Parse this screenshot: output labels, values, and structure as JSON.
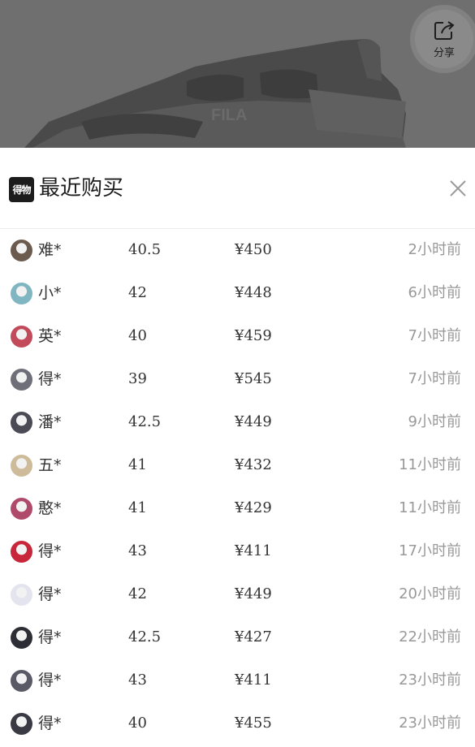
{
  "hero": {
    "share_label": "分享"
  },
  "sheet": {
    "brand_text": "得物",
    "title": "最近购买"
  },
  "purchases": [
    {
      "name": "难*",
      "size": "40.5",
      "price": "¥450",
      "time": "2小时前",
      "avatar_color": "#6b5a4e"
    },
    {
      "name": "小*",
      "size": "42",
      "price": "¥448",
      "time": "6小时前",
      "avatar_color": "#7fb6c2"
    },
    {
      "name": "英*",
      "size": "40",
      "price": "¥459",
      "time": "7小时前",
      "avatar_color": "#c24a5a"
    },
    {
      "name": "得*",
      "size": "39",
      "price": "¥545",
      "time": "7小时前",
      "avatar_color": "#6f6f7a"
    },
    {
      "name": "潘*",
      "size": "42.5",
      "price": "¥449",
      "time": "9小时前",
      "avatar_color": "#4b4b55"
    },
    {
      "name": "五*",
      "size": "41",
      "price": "¥432",
      "time": "11小时前",
      "avatar_color": "#cdbb9a"
    },
    {
      "name": "憨*",
      "size": "41",
      "price": "¥429",
      "time": "11小时前",
      "avatar_color": "#b04a6a"
    },
    {
      "name": "得*",
      "size": "43",
      "price": "¥411",
      "time": "17小时前",
      "avatar_color": "#c8263a"
    },
    {
      "name": "得*",
      "size": "42",
      "price": "¥449",
      "time": "20小时前",
      "avatar_color": "#e4e4ee"
    },
    {
      "name": "得*",
      "size": "42.5",
      "price": "¥427",
      "time": "22小时前",
      "avatar_color": "#2d2d36"
    },
    {
      "name": "得*",
      "size": "43",
      "price": "¥411",
      "time": "23小时前",
      "avatar_color": "#5a5a66"
    },
    {
      "name": "得*",
      "size": "40",
      "price": "¥455",
      "time": "23小时前",
      "avatar_color": "#3a3a44"
    }
  ]
}
